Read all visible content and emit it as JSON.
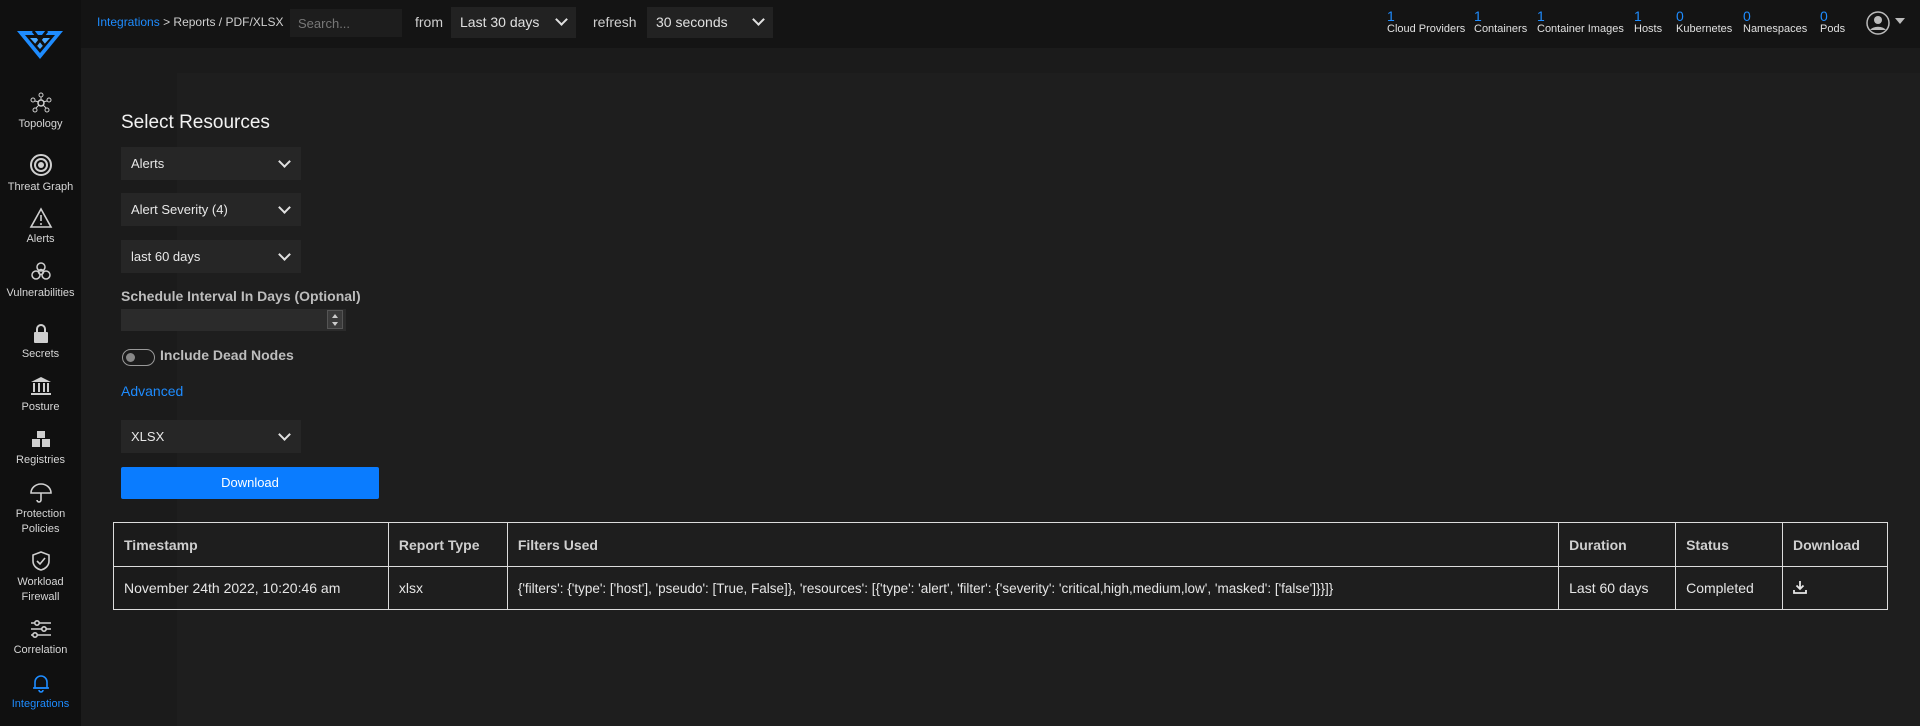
{
  "nav": [
    {
      "label": "Topology",
      "icon": "topology-icon"
    },
    {
      "label": "Threat Graph",
      "icon": "threat-graph-icon"
    },
    {
      "label": "Alerts",
      "icon": "alert-icon"
    },
    {
      "label": "Vulnerabilities",
      "icon": "biohazard-icon"
    },
    {
      "label": "Secrets",
      "icon": "lock-icon"
    },
    {
      "label": "Posture",
      "icon": "bank-icon"
    },
    {
      "label": "Registries",
      "icon": "registries-icon"
    },
    {
      "label": "Protection Policies",
      "icon": "umbrella-icon"
    },
    {
      "label": "Workload Firewall",
      "icon": "shield-icon"
    },
    {
      "label": "Correlation",
      "icon": "sliders-icon"
    },
    {
      "label": "Integrations",
      "icon": "bell-icon"
    }
  ],
  "header": {
    "breadcrumb_link": "Integrations",
    "breadcrumb_rest": "Reports / PDF/XLSX",
    "search_placeholder": "Search...",
    "from_label": "from",
    "from_value": "Last 30 days",
    "refresh_label": "refresh",
    "refresh_value": "30 seconds",
    "stats": [
      {
        "count": "1",
        "label": "Cloud Providers"
      },
      {
        "count": "1",
        "label": "Containers"
      },
      {
        "count": "1",
        "label": "Container Images"
      },
      {
        "count": "1",
        "label": "Hosts"
      },
      {
        "count": "0",
        "label": "Kubernetes"
      },
      {
        "count": "0",
        "label": "Namespaces"
      },
      {
        "count": "0",
        "label": "Pods"
      }
    ]
  },
  "form": {
    "title": "Select Resources",
    "resource": "Alerts",
    "severity": "Alert Severity (4)",
    "duration": "last 60 days",
    "interval_label": "Schedule Interval In Days (Optional)",
    "interval_value": "",
    "dead_nodes_label": "Include Dead Nodes",
    "dead_nodes_on": false,
    "advanced": "Advanced",
    "format": "XLSX",
    "download_button": "Download"
  },
  "table": {
    "headers": [
      "Timestamp",
      "Report Type",
      "Filters Used",
      "Duration",
      "Status",
      "Download"
    ],
    "rows": [
      {
        "timestamp": "November 24th 2022, 10:20:46 am",
        "type": "xlsx",
        "filters": "{'filters': {'type': ['host'], 'pseudo': [True, False]}, 'resources': [{'type': 'alert', 'filter': {'severity': 'critical,high,medium,low', 'masked': ['false']}}]}",
        "duration": "Last 60 days",
        "status": "Completed"
      }
    ]
  },
  "colors": {
    "accent": "#1e8cff",
    "button": "#0a7cff",
    "sidebar": "#101010",
    "background": "#1b1b1b"
  }
}
